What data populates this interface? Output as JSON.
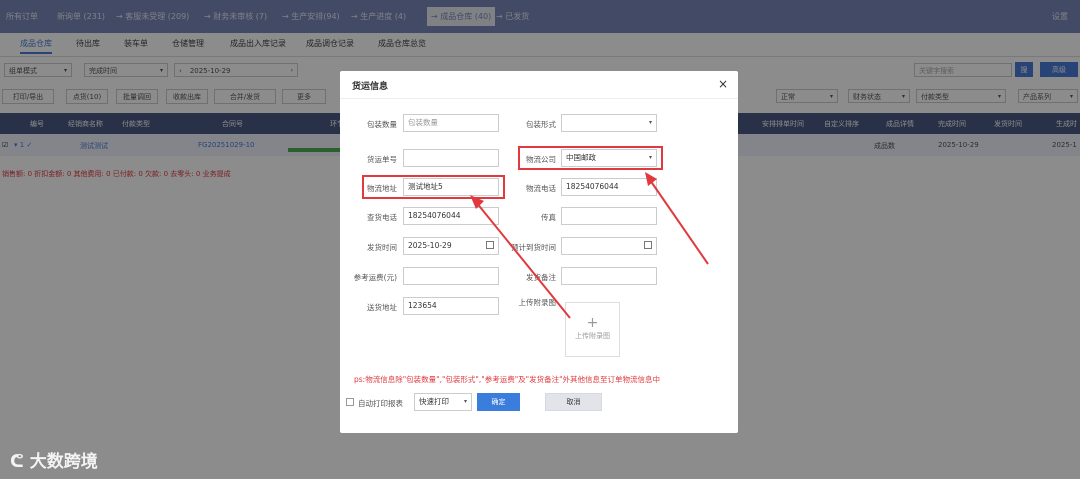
{
  "topbar": {
    "crumbs": [
      "所有订单",
      "新询单 (231)",
      "→ 客服未受理 (209)",
      "→ 财务未审核 (7)",
      "→ 生产安排(94)",
      "→ 生产进度 (4)",
      "→ 成品仓库 (40)",
      "→ 已发货"
    ],
    "settings": "设置"
  },
  "subtabs": [
    "成品仓库",
    "待出库",
    "装车单",
    "仓储管理",
    "成品出入库记录",
    "成品调仓记录",
    "成品仓库总览"
  ],
  "filters": {
    "mode": "组单模式",
    "time_type": "完成时间",
    "date": "2025-10-29",
    "keyword_placeholder": "关键字搜索",
    "search_btn": "搜",
    "advanced_btn": "高级"
  },
  "toolbar": {
    "print_export": "打印/导出",
    "check": "点货(10)",
    "batch_adjust": "批量调回",
    "finish_out": "收款出库",
    "merge_ship": "合并/发货",
    "more": "更多",
    "normal": "正常",
    "finance_status": "财务状态",
    "pay_type": "付款类型",
    "product_series": "产品系列"
  },
  "table": {
    "headers": [
      "编号",
      "经销商名称",
      "付款类型",
      "合同号",
      "环节",
      "安排排单时间",
      "自定义排序",
      "成品详情",
      "完成时间",
      "发货时间",
      "生成时"
    ],
    "row": {
      "index": "1",
      "dealer": "测试测试",
      "contract": "FG20251029-10",
      "detail": "成品数",
      "done_time": "2025-10-29",
      "gen_time": "2025-1"
    }
  },
  "summary": "销售额: 0   折扣金额: 0   其他费用: 0   已付款: 0   欠款: 0   去零头: 0   业务提成",
  "modal": {
    "title": "货运信息",
    "close": "×",
    "fields": {
      "pack_count_label": "包装数量",
      "pack_count_placeholder": "包装数量",
      "pack_type_label": "包装形式",
      "ship_no_label": "货运单号",
      "logistics_co_label": "物流公司",
      "logistics_co_value": "中国邮政",
      "logistics_addr_label": "物流地址",
      "logistics_addr_value": "测试地址5",
      "logistics_phone_label": "物流电话",
      "logistics_phone_value": "18254076044",
      "query_phone_label": "查货电话",
      "query_phone_value": "18254076044",
      "fax_label": "传真",
      "ship_time_label": "发货时间",
      "ship_time_value": "2025-10-29",
      "arrive_time_label": "预计到货时间",
      "ref_fee_label": "参考运费(元)",
      "ship_note_label": "发货备注",
      "delivery_addr_label": "送货地址",
      "delivery_addr_value": "123654",
      "upload_label": "上传附录图",
      "upload_text": "上传附录图"
    },
    "note": "ps:物流信息除\"包装数量\",\"包装形式\",\"参考运费\"及\"发货备注\"外其他信息至订单物流信息中",
    "auto_print_label": "自动打印报表",
    "print_mode": "快速打印",
    "confirm": "确定",
    "cancel": "取消"
  },
  "watermark": "大数跨境",
  "colors": {
    "accent": "#4a7cd8",
    "topbar": "#7a87b8",
    "highlight": "#e0393e"
  }
}
